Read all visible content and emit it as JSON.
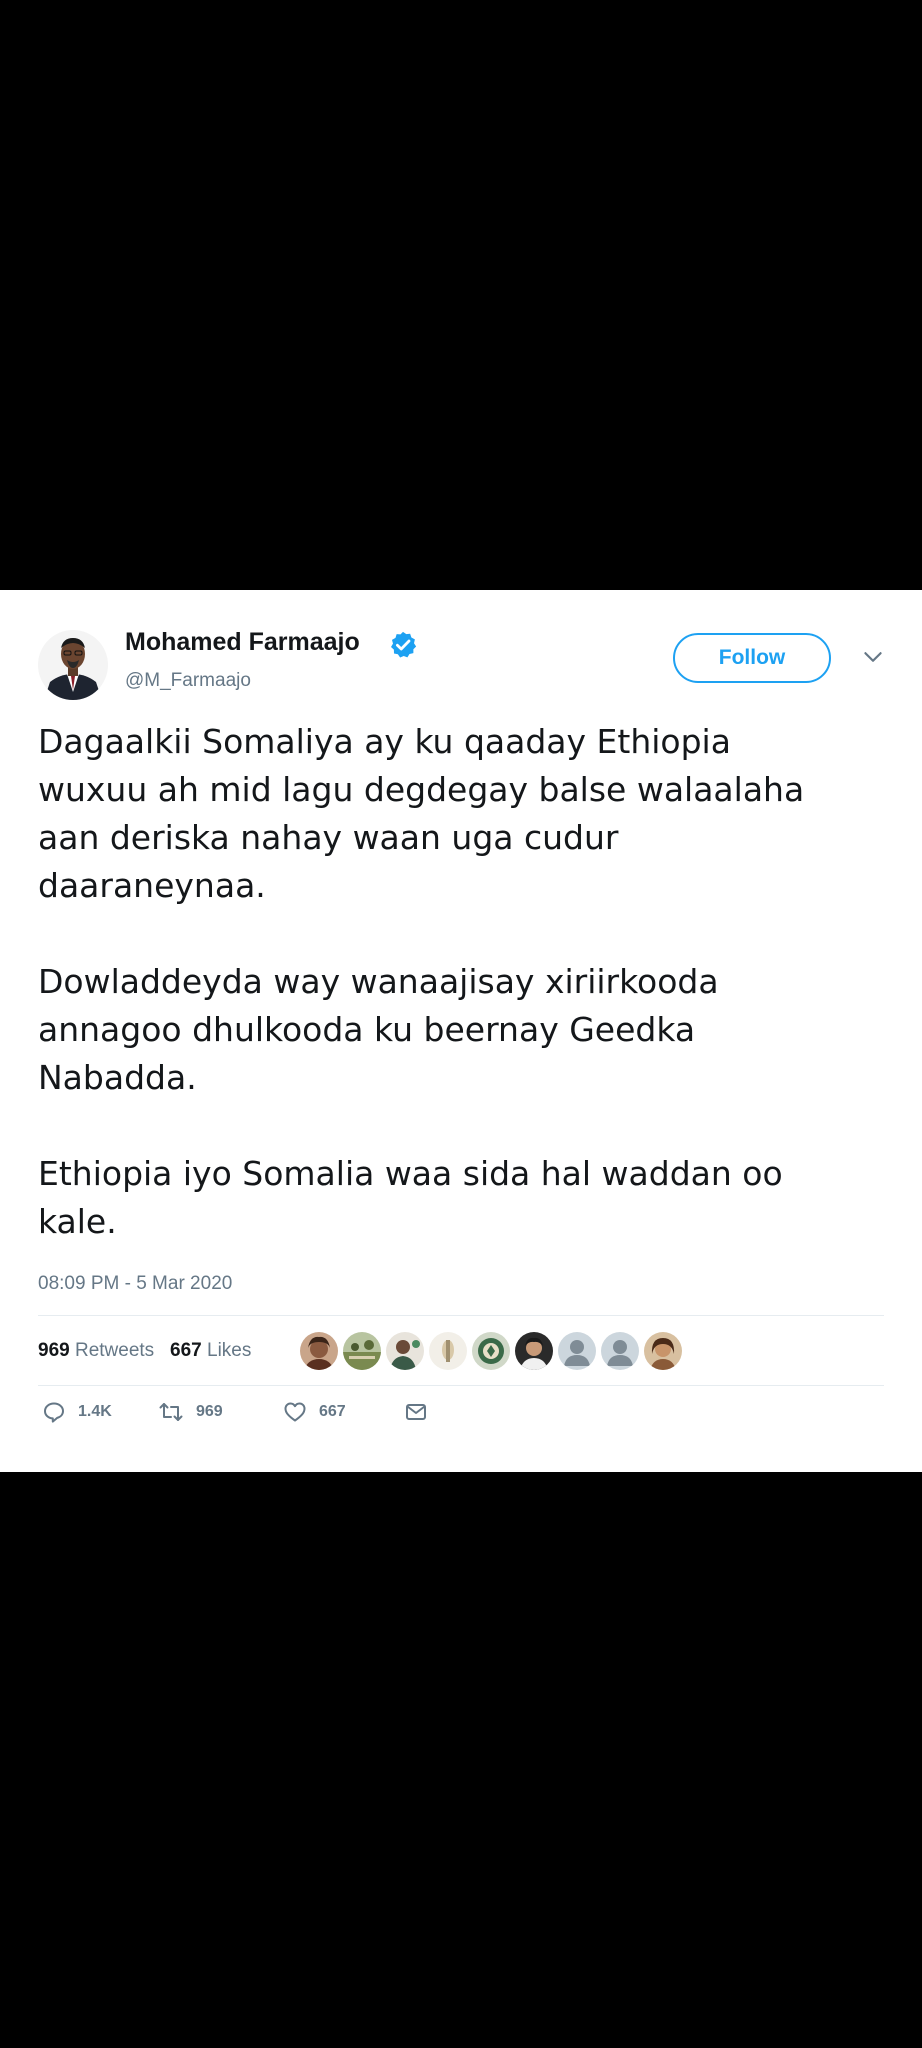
{
  "tweet": {
    "author": {
      "display_name": "Mohamed Farmaajo",
      "handle": "@M_Farmaajo",
      "verified": true
    },
    "follow_label": "Follow",
    "text": "Dagaalkii Somaliya ay ku qaaday Ethiopia\nwuxuu ah mid lagu degdegay balse walaalaha\naan deriska nahay waan uga cudur\ndaaraneynaa.\n\nDowladdeyda way wanaajisay xiriirkooda\nannagoo dhulkooda ku beernay Geedka\nNabadda.\n\nEthiopia iyo Somalia waa sida hal waddan oo\nkale.",
    "timestamp": "08:09 PM - 5 Mar 2020",
    "stats": {
      "retweets_count": "969",
      "retweets_label": "Retweets",
      "likes_count": "667",
      "likes_label": "Likes"
    },
    "likers_avatar_count": 9,
    "actions": {
      "replies": "1.4K",
      "retweets": "969",
      "likes": "667"
    }
  },
  "colors": {
    "accent": "#1da1f2",
    "secondary_text": "#657786",
    "primary_text": "#14171a",
    "background_outer": "#000000"
  },
  "icons": [
    "verified-badge-icon",
    "chevron-down-icon",
    "reply-icon",
    "retweet-icon",
    "like-icon",
    "direct-message-icon"
  ]
}
